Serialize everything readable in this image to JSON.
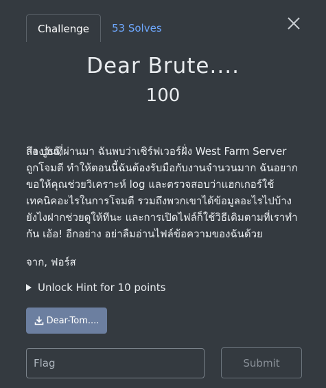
{
  "tabs": [
    {
      "label": "Challenge"
    },
    {
      "label": "53 Solves"
    }
  ],
  "icons": {
    "close": "close-icon",
    "download": "download-icon",
    "caret": "caret-right-icon"
  },
  "challenge": {
    "name": "Dear Brute....",
    "value": "100",
    "greeting": "ถึง บูธร์,",
    "body": "สองวันที่ผ่านมา ฉันพบว่าเซิร์ฟเวอร์ฝั่ง West Farm Server ถูกโจมตี ทำให้ตอนนี้ฉันต้องรับมือกับงานจำนวนมาก ฉันอยากขอให้คุณช่วยวิเคราะห์ log และตรวจสอบว่าแฮกเกอร์ใช้เทคนิคอะไรในการโจมตี รวมถึงพวกเขาได้ข้อมูลอะไรไปบ้าง ยังไงฝากช่วยดูให้ทีนะ และการเปิดไฟล์ก็ใช้วิธีเดิมตามที่เราทำกัน เอ้อ! อีกอย่าง อย่าลืมอ่านไฟล์ข้อความของฉันด้วย",
    "signature": "จาก, ฟอร์ส"
  },
  "hint": {
    "label": "Unlock Hint for 10 points"
  },
  "file": {
    "label": "Dear-Tom...."
  },
  "flag_input": {
    "placeholder": "Flag",
    "value": ""
  },
  "submit": {
    "label": "Submit"
  },
  "colors": {
    "background": "#343a40",
    "link": "#6ea8ff",
    "file_button": "#6c7fa0"
  }
}
